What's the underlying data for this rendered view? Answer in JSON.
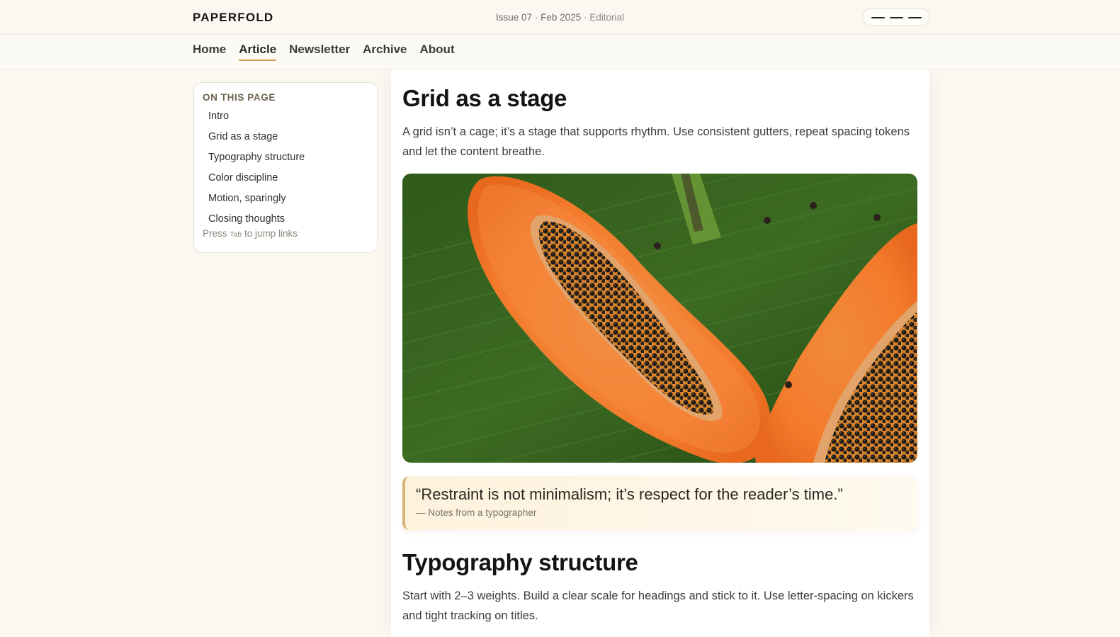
{
  "header": {
    "brand": "PAPERFOLD",
    "issue": "Issue 07",
    "date": "Feb 2025",
    "section": "Editorial",
    "separator": "·",
    "menu_icon": "hamburger-menu-icon"
  },
  "nav": {
    "items": [
      {
        "label": "Home"
      },
      {
        "label": "Article"
      },
      {
        "label": "Newsletter"
      },
      {
        "label": "Archive"
      },
      {
        "label": "About"
      }
    ],
    "active": "Article"
  },
  "toc": {
    "title": "ON THIS PAGE",
    "items": [
      {
        "label": "Intro"
      },
      {
        "label": "Grid as a stage"
      },
      {
        "label": "Typography structure"
      },
      {
        "label": "Color discipline"
      },
      {
        "label": "Motion, sparingly"
      },
      {
        "label": "Closing thoughts"
      }
    ],
    "hint_before": "Press",
    "hint_key": "Tab",
    "hint_after": "to jump links"
  },
  "article": {
    "section1": {
      "heading": "Grid as a stage",
      "body": "A grid isn’t a cage; it’s a stage that supports rhythm. Use consistent gutters, repeat spacing tokens and let the content breathe."
    },
    "image": {
      "subject": "papaya-halves-on-banana-leaf"
    },
    "quote": {
      "text": "“Restraint is not minimalism; it’s respect for the reader’s time.”",
      "source": "— Notes from a typographer"
    },
    "section2": {
      "heading": "Typography structure",
      "body": "Start with 2–3 weights. Build a clear scale for headings and stick to it. Use letter-spacing on kickers and tight tracking on titles."
    }
  },
  "colors": {
    "background": "#fbf8f1",
    "accent": "#d79b56",
    "quote_border": "#d8b277",
    "quote_bg": "#fdf2dc"
  }
}
